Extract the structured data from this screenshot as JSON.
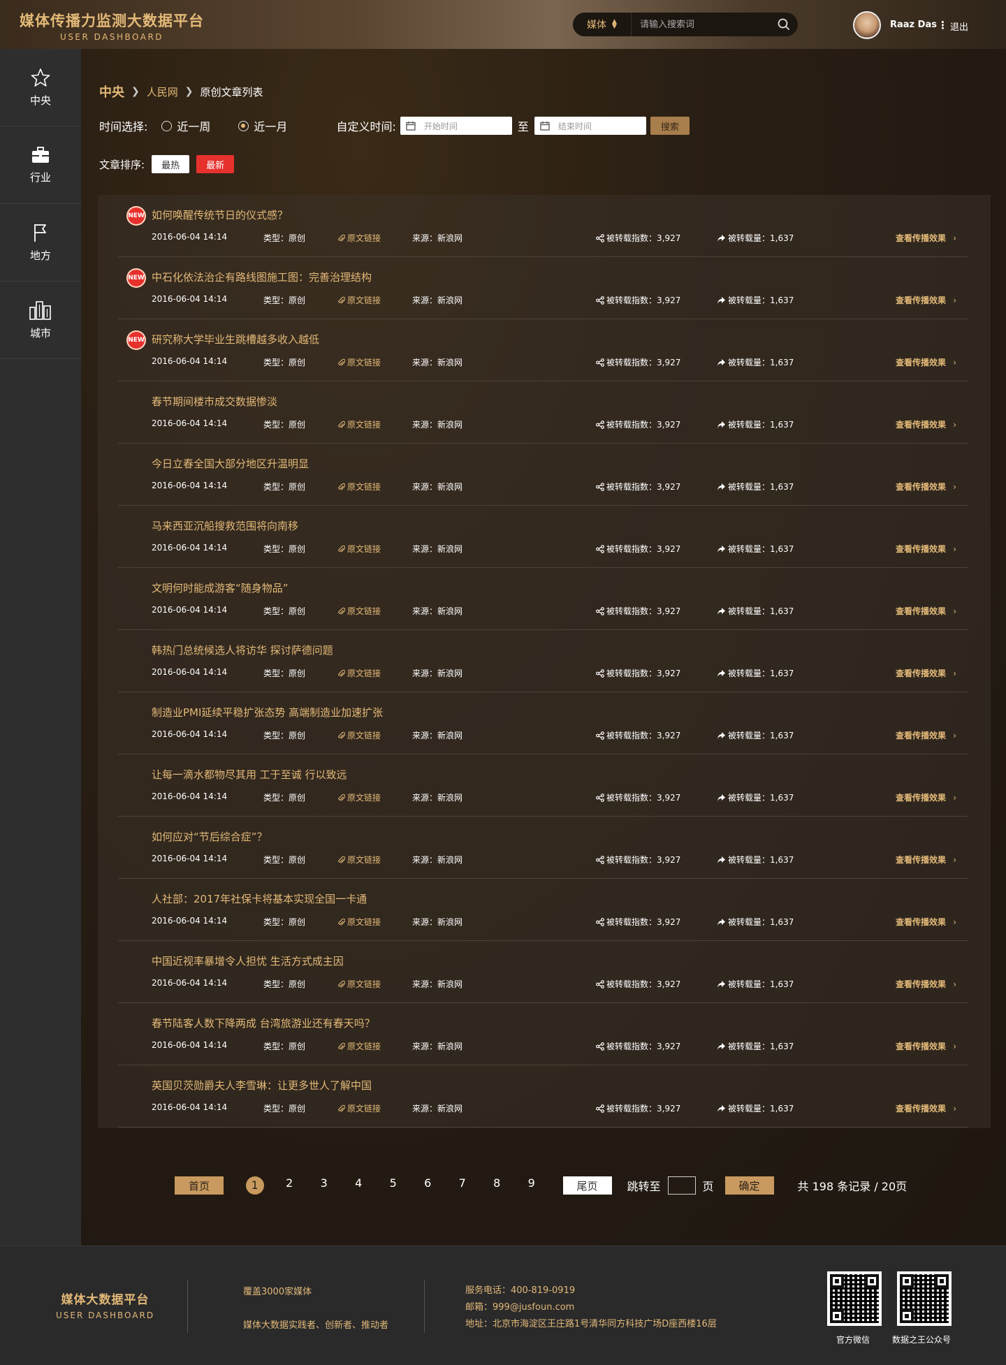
{
  "header": {
    "title": "媒体传播力监测大数据平台",
    "subtitle": "USER DASHBOARD",
    "search_category": "媒体",
    "search_placeholder": "请输入搜索词",
    "username": "Raaz Das",
    "logout": "退出"
  },
  "sidebar": {
    "items": [
      {
        "label": "中央",
        "icon": "star-icon"
      },
      {
        "label": "行业",
        "icon": "briefcase-icon"
      },
      {
        "label": "地方",
        "icon": "flag-icon"
      },
      {
        "label": "城市",
        "icon": "buildings-icon"
      }
    ]
  },
  "breadcrumb": [
    "中央",
    "人民网",
    "原创文章列表"
  ],
  "filters": {
    "time_label": "时间选择:",
    "week": "近一周",
    "month": "近一月",
    "selected": "近一月",
    "custom_label": "自定义时间:",
    "start_placeholder": "开始时间",
    "to": "至",
    "end_placeholder": "结束时间",
    "search_button": "搜索"
  },
  "sort": {
    "label": "文章排序:",
    "hot": "最热",
    "newest": "最新"
  },
  "article_meta": {
    "date": "2016-06-04 14:14",
    "type": "类型：原创",
    "link": "原文链接",
    "source": "来源：新浪网",
    "index": "被转载指数：3,927",
    "count": "被转载量：1,637",
    "view": "查看传播效果"
  },
  "articles": [
    {
      "title": "如何唤醒传统节日的仪式感？",
      "is_new": true
    },
    {
      "title": "中石化依法治企有路线图施工图：完善治理结构",
      "is_new": true
    },
    {
      "title": "研究称大学毕业生跳槽越多收入越低",
      "is_new": true
    },
    {
      "title": "春节期间楼市成交数据惨淡",
      "is_new": false
    },
    {
      "title": "今日立春全国大部分地区升温明显",
      "is_new": false
    },
    {
      "title": "马来西亚沉船搜救范围将向南移",
      "is_new": false
    },
    {
      "title": "文明何时能成游客“随身物品”",
      "is_new": false
    },
    {
      "title": "韩热门总统候选人将访华 探讨萨德问题",
      "is_new": false
    },
    {
      "title": "制造业PMI延续平稳扩张态势 高端制造业加速扩张",
      "is_new": false
    },
    {
      "title": "让每一滴水都物尽其用 工于至诚 行以致远",
      "is_new": false
    },
    {
      "title": "如何应对“节后综合症”？",
      "is_new": false
    },
    {
      "title": "人社部：2017年社保卡将基本实现全国一卡通",
      "is_new": false
    },
    {
      "title": "中国近视率暴增令人担忧 生活方式成主因",
      "is_new": false
    },
    {
      "title": "春节陆客人数下降两成 台湾旅游业还有春天吗？",
      "is_new": false
    },
    {
      "title": "英国贝茨勋爵夫人李雪琳：让更多世人了解中国",
      "is_new": false
    }
  ],
  "new_badge": "NEW",
  "pagination": {
    "first": "首页",
    "pages": [
      "1",
      "2",
      "3",
      "4",
      "5",
      "6",
      "7",
      "8",
      "9"
    ],
    "current": "1",
    "last": "尾页",
    "jump_label": "跳转至",
    "page_unit": "页",
    "confirm": "确定",
    "summary": "共 198 条记录 / 20页"
  },
  "footer": {
    "title": "媒体大数据平台",
    "subtitle": "USER DASHBOARD",
    "coverage": "覆盖3000家媒体",
    "slogan": "媒体大数据实践者、创新者、推动者",
    "phone": "服务电话：400-819-0919",
    "email": "邮箱：999@jusfoun.com",
    "address": "地址：北京市海淀区王庄路1号清华同方科技广场D座西楼16层",
    "qr1_label": "官方微信",
    "qr2_label": "数据之王公众号"
  },
  "colors": {
    "accent": "#e3b978",
    "new_badge": "#e6312d",
    "button": "#c99a5f"
  }
}
